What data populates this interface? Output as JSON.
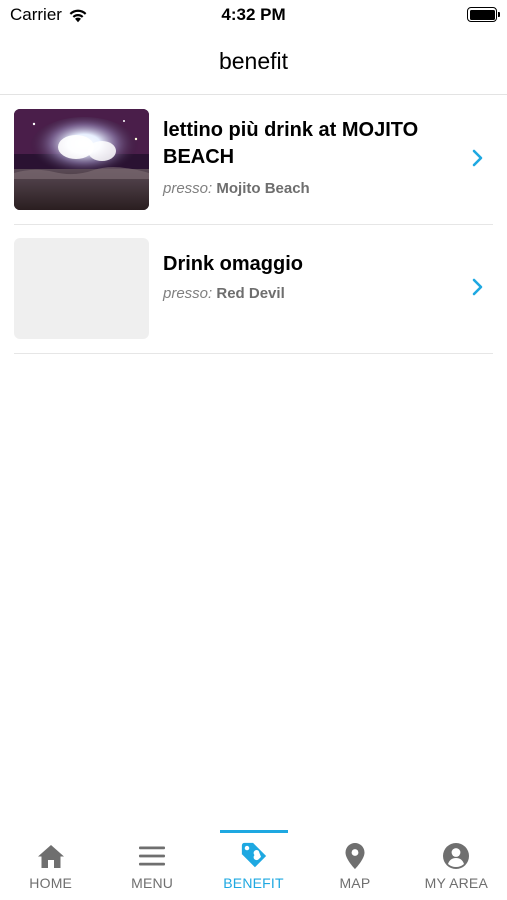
{
  "status_bar": {
    "carrier": "Carrier",
    "time": "4:32 PM"
  },
  "nav": {
    "title": "benefit"
  },
  "benefits": [
    {
      "title": "lettino più drink at MOJITO BEACH",
      "presso_label": "presso:",
      "venue": "Mojito Beach",
      "has_image": true
    },
    {
      "title": "Drink omaggio",
      "presso_label": "presso:",
      "venue": "Red Devil",
      "has_image": false
    }
  ],
  "tabs": [
    {
      "label": "HOME",
      "icon": "home-icon",
      "active": false
    },
    {
      "label": "MENU",
      "icon": "menu-icon",
      "active": false
    },
    {
      "label": "BENEFIT",
      "icon": "tag-icon",
      "active": true
    },
    {
      "label": "MAP",
      "icon": "map-pin-icon",
      "active": false
    },
    {
      "label": "MY AREA",
      "icon": "account-icon",
      "active": false
    }
  ],
  "colors": {
    "accent": "#1ea8e1",
    "tab_inactive": "#6f6f6f",
    "subtitle": "#6e6e6e",
    "divider": "#e6e6e6"
  }
}
